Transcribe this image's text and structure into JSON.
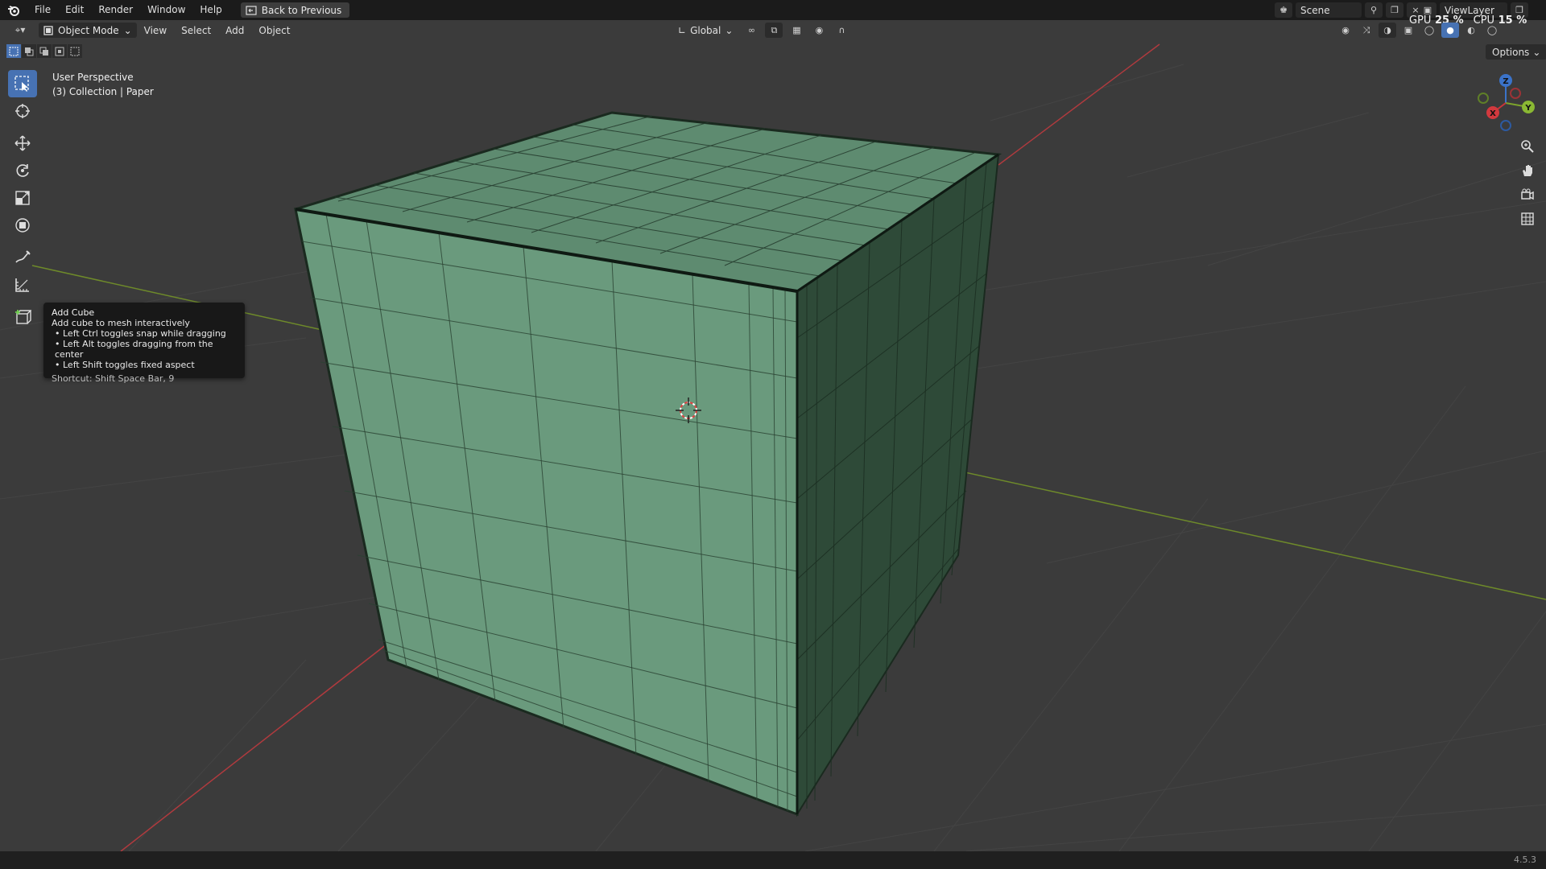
{
  "menu": {
    "file": "File",
    "edit": "Edit",
    "render": "Render",
    "window": "Window",
    "help": "Help",
    "back_button": "Back to Previous"
  },
  "scene": {
    "name": "Scene"
  },
  "view_layer": {
    "name": "ViewLayer"
  },
  "stats": {
    "gpu_label": "GPU",
    "gpu_value": "25 %",
    "cpu_label": "CPU",
    "cpu_value": "15 %"
  },
  "header": {
    "mode": "Object Mode",
    "view": "View",
    "select": "Select",
    "add": "Add",
    "object": "Object",
    "transform_orientation": "Global",
    "options": "Options"
  },
  "viewport": {
    "perspective": "User Perspective",
    "collection": "(3) Collection | Paper"
  },
  "tooltip": {
    "title": "Add Cube",
    "description": "Add cube to mesh interactively",
    "items": [
      "• Left Ctrl toggles snap while dragging",
      "• Left Alt toggles dragging from the center",
      "• Left Shift toggles fixed aspect"
    ],
    "shortcut": "Shortcut: Shift Space Bar, 9"
  },
  "gizmo": {
    "x": "X",
    "y": "Y",
    "z": "Z"
  },
  "status": {
    "version": "4.5.3"
  },
  "colors": {
    "accent": "#4772b3",
    "mesh_face": "#628f74",
    "x_axis": "#c0393e",
    "y_axis": "#7a9a2c"
  }
}
